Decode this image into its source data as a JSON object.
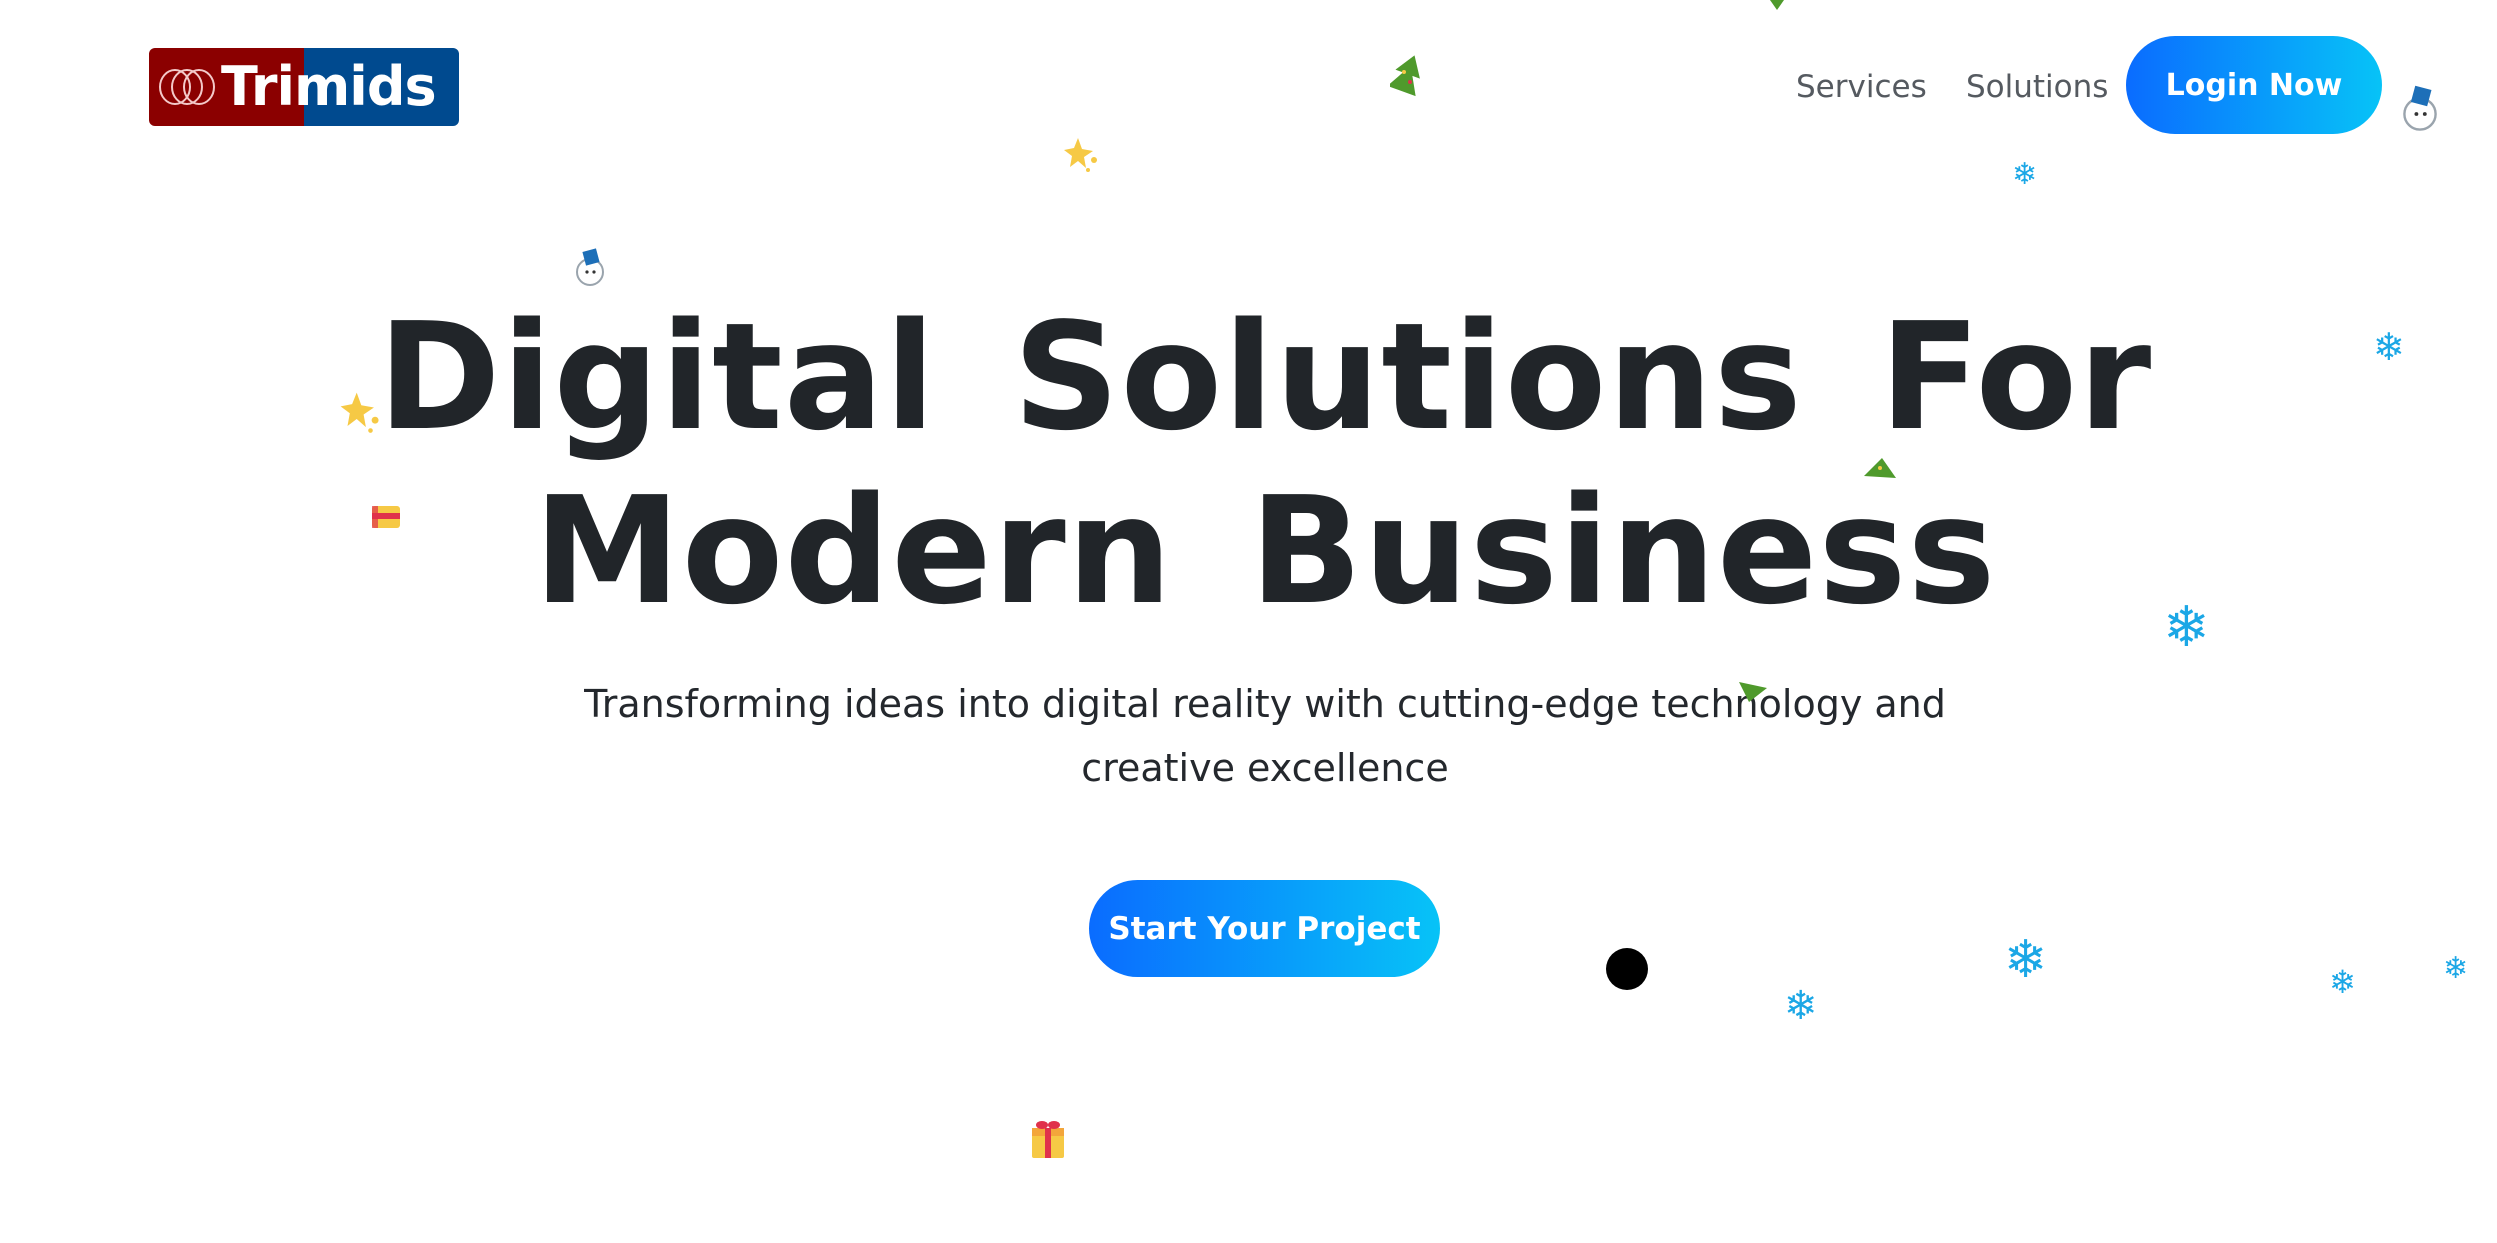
{
  "header": {
    "logo_text": "Trimids",
    "nav": [
      {
        "label": "Services"
      },
      {
        "label": "Solutions"
      }
    ],
    "login_label": "Login Now"
  },
  "hero": {
    "title": "Digital Solutions For Modern Business",
    "subtitle": "Transforming ideas into digital reality with cutting-edge technology and creative excellence",
    "cta_label": "Start Your Project"
  },
  "colors": {
    "logo_red": "#8b0000",
    "logo_blue": "#004a8f",
    "gradient_start": "#0a6cff",
    "gradient_end": "#07c3f7",
    "title_text": "#212529",
    "snowflake": "#1ba7e6"
  },
  "decorations": {
    "icons": [
      "snowflake-icon",
      "star-icon",
      "gift-icon",
      "tree-icon",
      "snowman-icon",
      "mouse-cursor-dot"
    ]
  }
}
